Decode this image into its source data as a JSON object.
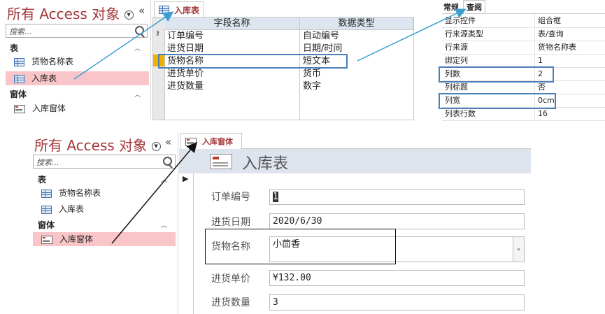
{
  "nav_top": {
    "title": "所有 Access 对象",
    "collapse": "«",
    "search_placeholder": "搜索...",
    "groups": [
      {
        "label": "表",
        "chevron": "⌃",
        "items": [
          "货物名称表",
          "入库表"
        ]
      },
      {
        "label": "窗体",
        "chevron": "⌃",
        "items": [
          "入库窗体"
        ]
      }
    ],
    "selected": "入库表"
  },
  "table_design": {
    "tab_label": "入库表",
    "columns": [
      "字段名称",
      "数据类型"
    ],
    "rows": [
      {
        "field": "订单编号",
        "type": "自动编号"
      },
      {
        "field": "进货日期",
        "type": "日期/时间"
      },
      {
        "field": "货物名称",
        "type": "短文本"
      },
      {
        "field": "进货单价",
        "type": "货币"
      },
      {
        "field": "进货数量",
        "type": "数字"
      }
    ],
    "key_row": 0,
    "selected_row": 2
  },
  "property_sheet": {
    "tabs": [
      "常规",
      "查阅"
    ],
    "active_tab": "查阅",
    "rows": [
      {
        "key": "显示控件",
        "value": "组合框"
      },
      {
        "key": "行来源类型",
        "value": "表/查询"
      },
      {
        "key": "行来源",
        "value": "货物名称表"
      },
      {
        "key": "绑定列",
        "value": "1"
      },
      {
        "key": "列数",
        "value": "2"
      },
      {
        "key": "列标题",
        "value": "否"
      },
      {
        "key": "列宽",
        "value": "0cm"
      },
      {
        "key": "列表行数",
        "value": "16"
      }
    ],
    "highlighted": [
      "列数",
      "列宽"
    ]
  },
  "nav_bottom": {
    "title": "所有 Access 对象",
    "collapse": "«",
    "search_placeholder": "搜索...",
    "groups": [
      {
        "label": "表",
        "chevron": "⌃",
        "items": [
          "货物名称表",
          "入库表"
        ]
      },
      {
        "label": "窗体",
        "chevron": "⌃",
        "items": [
          "入库窗体"
        ]
      }
    ],
    "selected": "入库窗体"
  },
  "form_view": {
    "tab_label": "入库窗体",
    "header_title": "入库表",
    "record_indicator": "▶",
    "fields": [
      {
        "label": "订单编号",
        "value": "1"
      },
      {
        "label": "进货日期",
        "value": "2020/6/30"
      },
      {
        "label": "货物名称",
        "value": "小茴香"
      },
      {
        "label": "进货单价",
        "value": "¥132.00"
      },
      {
        "label": "进货数量",
        "value": "3"
      }
    ],
    "combo_arrow": "⌄"
  },
  "colors": {
    "title_red": "#a4373a",
    "selection_pink": "#f9c5c8",
    "highlight_blue": "#4a7fb8",
    "arrow_blue": "#3a9fd0",
    "header_blue": "#dde6f0"
  }
}
